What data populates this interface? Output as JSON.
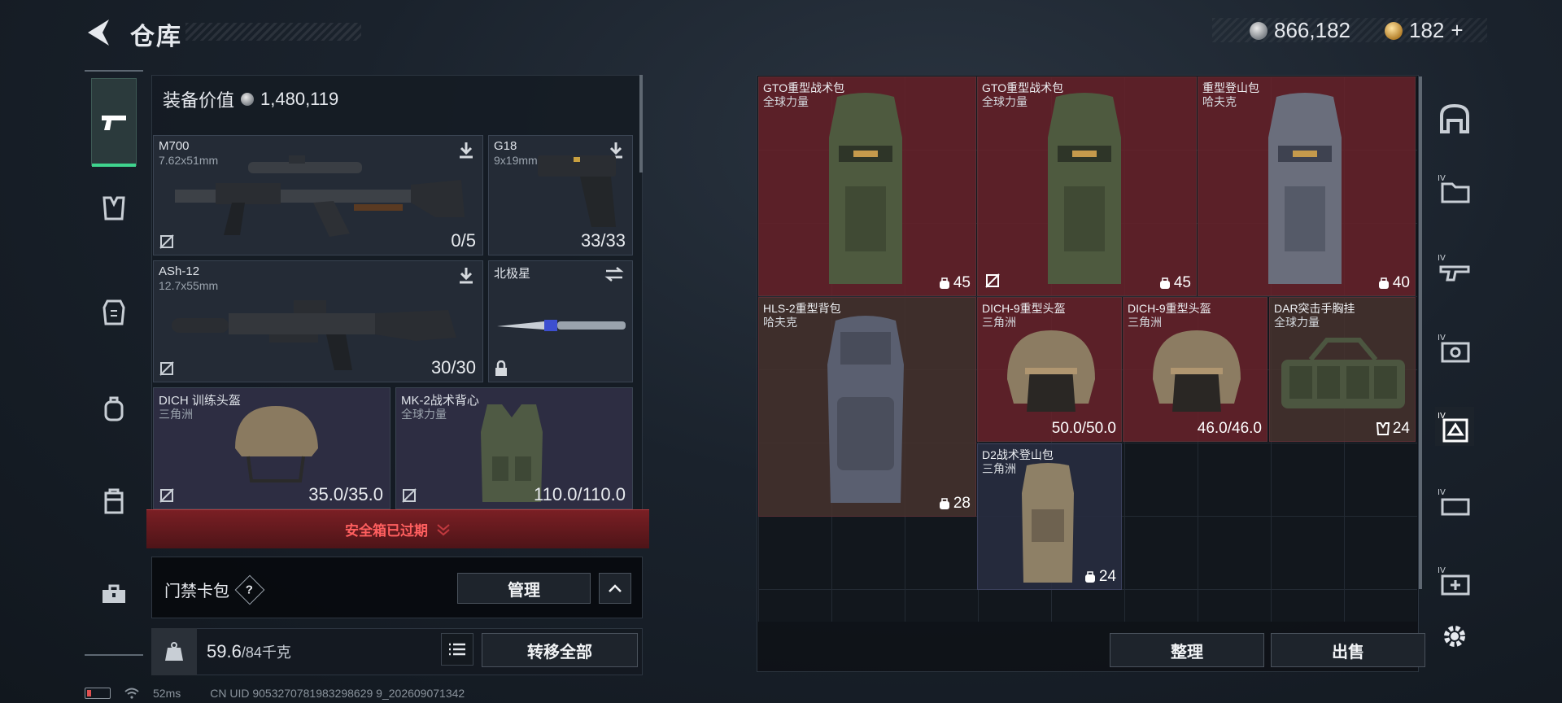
{
  "header": {
    "title": "仓库",
    "silver_amount": "866,182",
    "gold_amount": "182",
    "gold_plus": "+"
  },
  "equipment": {
    "value_label": "装备价值",
    "value": "1,480,119",
    "slots": [
      {
        "name": "M700",
        "sub": "7.62x51mm",
        "count": "0/5"
      },
      {
        "name": "G18",
        "sub": "9x19mm",
        "count": "33/33"
      },
      {
        "name": "ASh-12",
        "sub": "12.7x55mm",
        "count": "30/30"
      },
      {
        "name": "北极星",
        "sub": "",
        "count": ""
      },
      {
        "name": "DICH 训练头盔",
        "sub": "三角洲",
        "count": "35.0/35.0"
      },
      {
        "name": "MK-2战术背心",
        "sub": "全球力量",
        "count": "110.0/110.0"
      }
    ],
    "safe_box_text": "安全箱已过期",
    "keycard_label": "门禁卡包",
    "keycard_help": "?",
    "manage_button": "管理",
    "weight_current": "59.6",
    "weight_max": "/84千克",
    "transfer_all_button": "转移全部"
  },
  "storage": {
    "items": [
      {
        "name": "GTO重型战术包",
        "sub": "全球力量",
        "cap": "45"
      },
      {
        "name": "GTO重型战术包",
        "sub": "全球力量",
        "cap": "45"
      },
      {
        "name": "重型登山包",
        "sub": "哈夫克",
        "cap": "40"
      },
      {
        "name": "HLS-2重型背包",
        "sub": "哈夫克",
        "cap": "28"
      },
      {
        "name": "DICH-9重型头盔",
        "sub": "三角洲",
        "cap": "50.0/50.0"
      },
      {
        "name": "DICH-9重型头盔",
        "sub": "三角洲",
        "cap": "46.0/46.0"
      },
      {
        "name": "DAR突击手胸挂",
        "sub": "全球力量",
        "cap": "24"
      },
      {
        "name": "D2战术登山包",
        "sub": "三角洲",
        "cap": "24"
      }
    ],
    "sort_button": "整理",
    "sell_button": "出售"
  },
  "status": {
    "ping": "52ms",
    "uid": "CN UID 9053270781983298629 9_202609071342"
  },
  "colors": {
    "accent_green": "#3fd48e",
    "alert_red": "#ff5f5f",
    "rare_red": "#68222a",
    "epic_blue": "#282c40"
  }
}
